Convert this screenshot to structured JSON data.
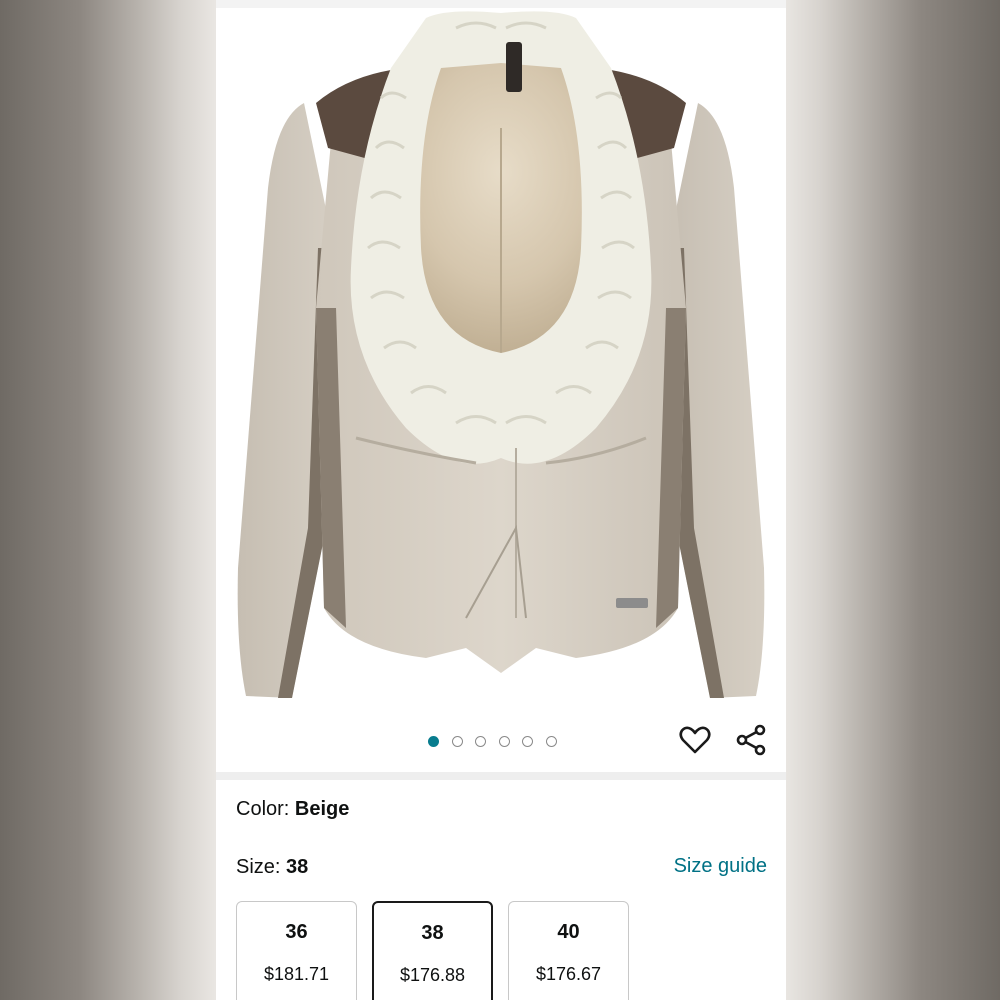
{
  "gallery": {
    "product_image_alt": "Beige jacket with knit scarf collar",
    "dot_count": 6,
    "active_dot_index": 0,
    "favorite_icon": "heart-icon",
    "share_icon": "share-icon"
  },
  "selection": {
    "color_label": "Color:",
    "color_value": "Beige",
    "size_label": "Size:",
    "size_value": "38",
    "size_guide_label": "Size guide"
  },
  "sizes": [
    {
      "size": "36",
      "price": "$181.71",
      "selected": false
    },
    {
      "size": "38",
      "price": "$176.88",
      "selected": true
    },
    {
      "size": "40",
      "price": "$176.67",
      "selected": false
    }
  ],
  "colors": {
    "accent": "#087c8e",
    "link": "#007185",
    "text": "#0f1111"
  }
}
